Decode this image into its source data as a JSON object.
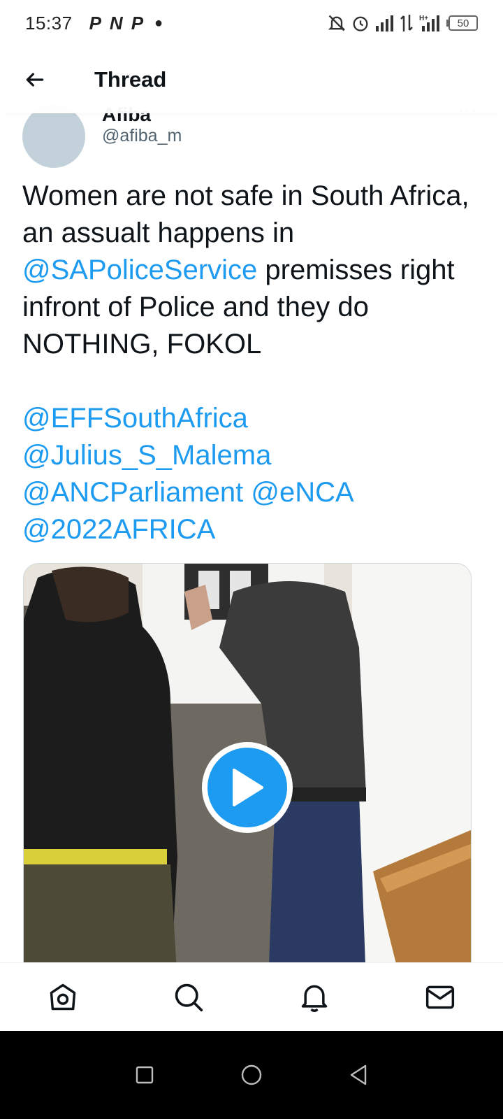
{
  "status_bar": {
    "time": "15:37",
    "notification_letters": [
      "P",
      "N",
      "P"
    ],
    "battery_level": "50"
  },
  "header": {
    "title": "Thread"
  },
  "tweet": {
    "author_name": "Afiba",
    "author_handle": "@afiba_m",
    "more_label": "···",
    "text_part1": "Women are not safe in South Africa, an assualt happens in ",
    "mention_sapolice": "@SAPoliceService",
    "text_part2": " premisses right infront of Police and they do NOTHING, FOKOL",
    "mentions": [
      "@EFFSouthAfrica",
      "@Julius_S_Malema",
      "@ANCParliament",
      "@eNCA",
      "@2022AFRICA"
    ]
  },
  "colors": {
    "link": "#1d9bf0",
    "text": "#0f1419",
    "secondary": "#536471",
    "avatar": "#c2d1da"
  },
  "bottom_nav": {
    "items": [
      "home-icon",
      "search-icon",
      "notifications-icon",
      "messages-icon"
    ]
  }
}
